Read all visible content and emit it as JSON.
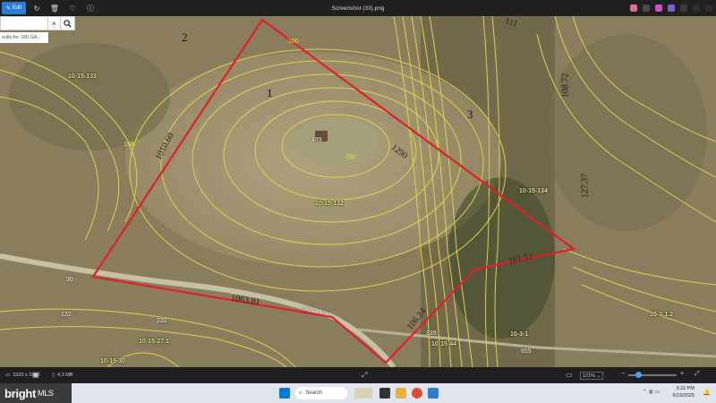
{
  "window": {
    "title": "Screenshot (33).png",
    "edit_label": "Edit",
    "icons": [
      "rotate-icon",
      "delete-icon",
      "heart-icon",
      "info-icon"
    ]
  },
  "search": {
    "value": "sults for 189 GA...",
    "clear": "×"
  },
  "map": {
    "parcel_numbers": [
      "1",
      "2",
      "3"
    ],
    "lots": [
      "10-15-133",
      "10-15-132",
      "10-15-134",
      "10-15-44",
      "10-15-27.1",
      "10-15-30",
      "10-3-1",
      "10-3-1.2",
      "10-15-30"
    ],
    "dimensions": [
      "1010.60",
      "1290",
      "161.51",
      "1063.81",
      "106.24",
      "108.72",
      "127.37",
      "111"
    ],
    "house_numbers": [
      "189",
      "132",
      "232",
      "339",
      "655"
    ],
    "contour_labels": [
      "160",
      "150",
      "150"
    ],
    "road_name": "GABLE RD",
    "lot_small": "30"
  },
  "statusbar": {
    "dimensions": "1920 x 1080",
    "size": "4.3 MB",
    "zoom": "121%"
  },
  "taskbar": {
    "brand": "bright",
    "brand_suffix": "MLS",
    "search_placeholder": "Search",
    "time": "3:22 PM",
    "date": "6/19/2025"
  },
  "colors": {
    "boundary": "#e21f26",
    "contour": "#e3d84a",
    "accent": "#2b7fd3"
  }
}
